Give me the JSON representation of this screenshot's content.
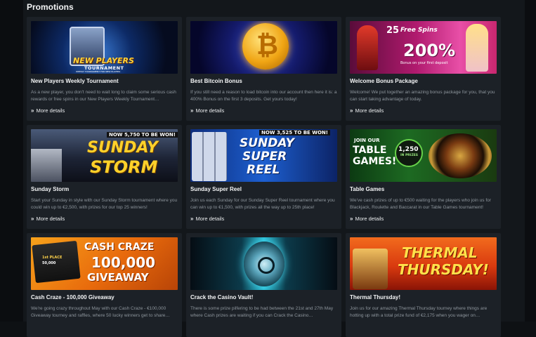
{
  "header": {
    "title": "Promotions"
  },
  "more_label": "More details",
  "colors": {
    "background": "#13171b",
    "card": "#1c2127",
    "accent_orange": "#f08a1c",
    "text_muted": "#8e969d"
  },
  "promotions": [
    {
      "title": "New Players Weekly Tournament",
      "description": "As a new player, you don't need to wait long to claim some serious cash rewards or free spins in our New Players Weekly Tournament…",
      "banner": {
        "line1": "NEW PLAYERS",
        "line2": "TOURNAMENT",
        "line3": "WEEKLY TOURNAMENT FOR NEW PLAYERS"
      }
    },
    {
      "title": "Best Bitcoin Bonus",
      "description": "If you still need a reason to load bitcoin into our account then here it is: a 400% Bonus on the first 3 deposits. Get yours today!",
      "banner": {
        "symbol": "₿"
      }
    },
    {
      "title": "Welcome Bonus Package",
      "description": "Welcome! We put together an amazing bonus package for you, that you can start taking advantage of today.",
      "banner": {
        "line1": "25",
        "line2": "Free Spins",
        "line3": "200%",
        "line4": "Bonus on your first deposit"
      }
    },
    {
      "title": "Sunday Storm",
      "description": "Start your Sunday in style with our Sunday Storm tournament where you could win up to €2,500, with prizes for our top 25 winners!",
      "banner": {
        "line1": "NOW 5,750 TO BE WON!",
        "line2": "SUNDAY",
        "line3": "STORM"
      }
    },
    {
      "title": "Sunday Super Reel",
      "description": "Join us each Sunday for our Sunday Super Reel tournament where you can win up to €1,500, with prizes all the way up to 25th place!",
      "banner": {
        "line1": "NOW 3,525 TO BE WON!",
        "line2": "SUNDAY",
        "line3": "SUPER",
        "line4": "REEL"
      }
    },
    {
      "title": "Table Games",
      "description": "We've cash prizes of up to €500 waiting for the players who join us for Blackjack, Roulette and Baccarat in our Table Games tournament!",
      "banner": {
        "line1": "JOIN OUR",
        "line2": "TABLE",
        "line3": "GAMES!",
        "line4": "1,250",
        "line5": "IN PRIZES"
      }
    },
    {
      "title": "Cash Craze - 100,000 Giveaway",
      "description": "We're going crazy throughout May with our Cash Craze - €100,000 Giveaway tourney and raffles, where 50 lucky winners get to share…",
      "banner": {
        "line1": "CASH CRAZE",
        "line2": "100,000",
        "line3": "GIVEAWAY",
        "line4": "1st PLACE",
        "line5": "50,000"
      }
    },
    {
      "title": "Crack the Casino Vault!",
      "description": "There is some prize pilfering to be had between the 21st and 27th May where Cash prizes are waiting if you can Crack the Casino…",
      "banner": {}
    },
    {
      "title": "Thermal Thursday!",
      "description": "Join us for our amazing Thermal Thursday tourney where things are hotting up with a total prize fund of €2,175 when you wager on…",
      "banner": {
        "line1": "THERMAL",
        "line2": "THURSDAY!"
      }
    }
  ]
}
